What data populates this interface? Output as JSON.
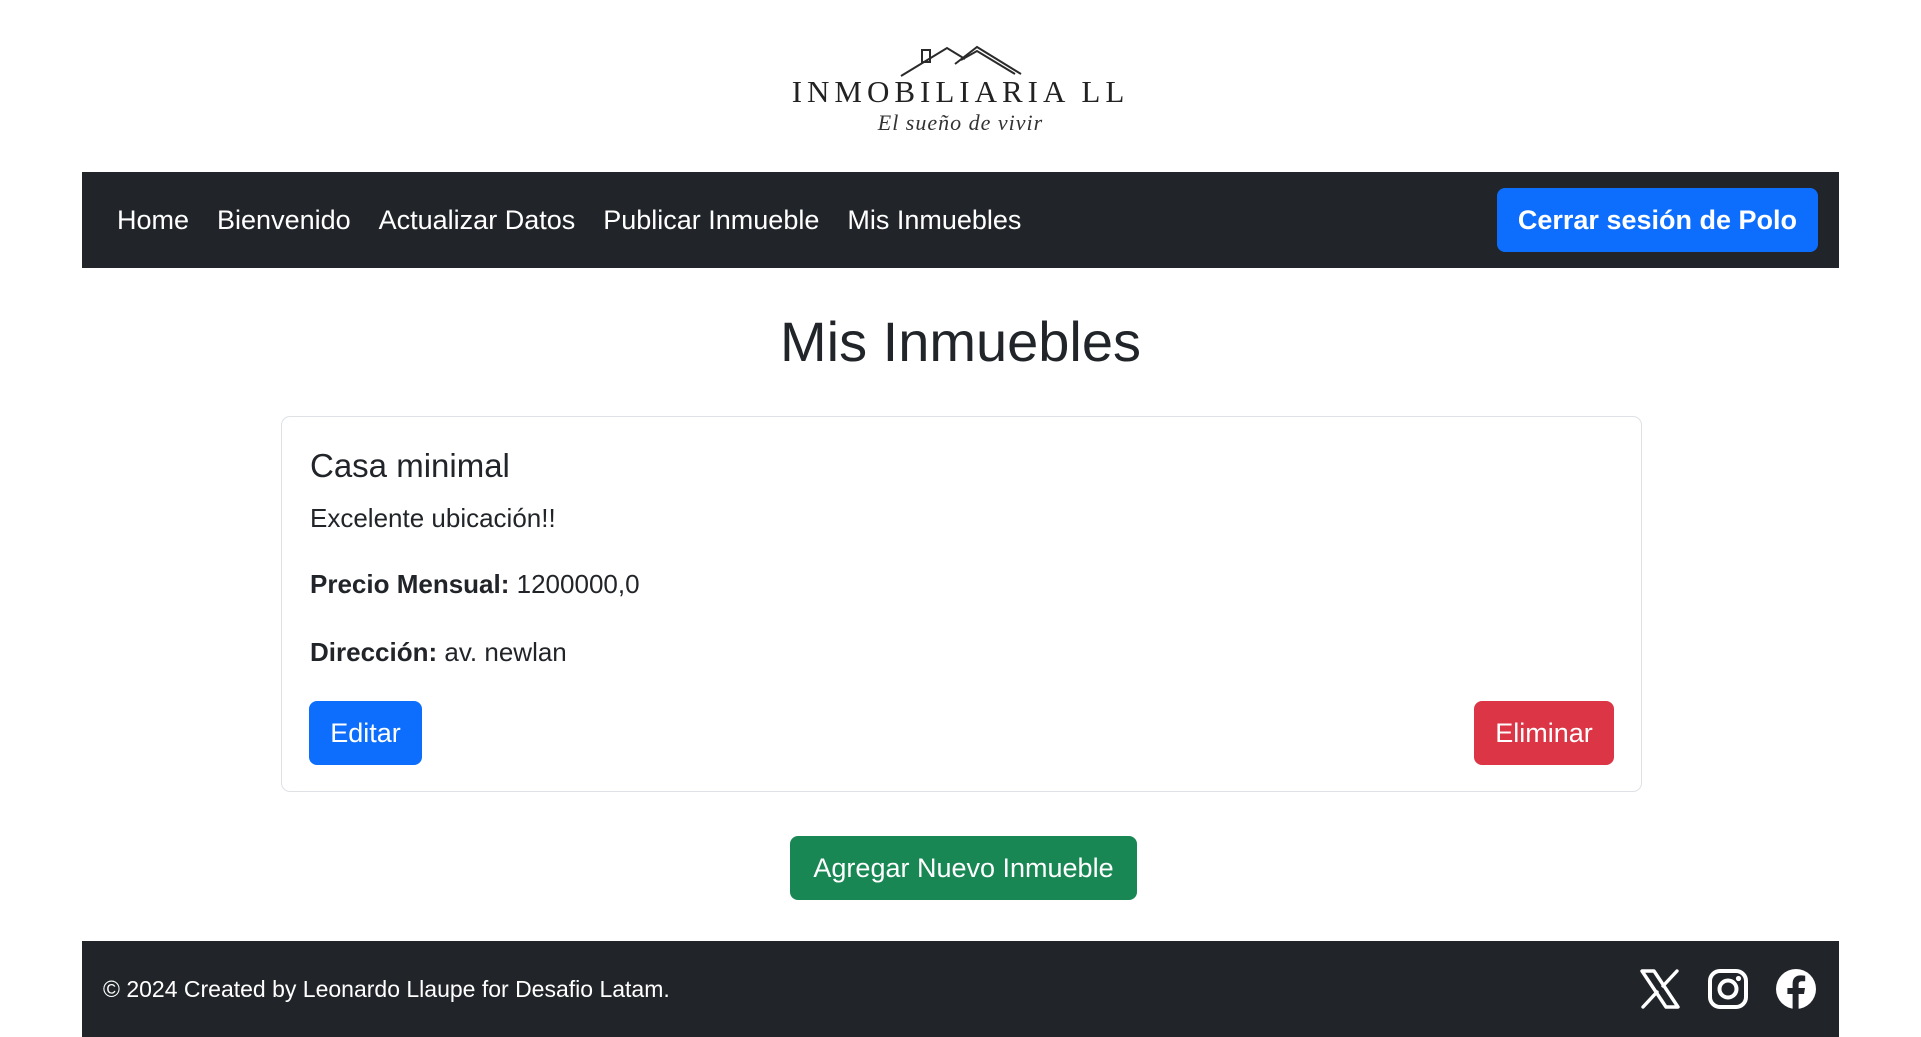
{
  "brand": {
    "name": "INMOBILIARIA LL",
    "tagline": "El sueño de vivir"
  },
  "nav": {
    "links": [
      "Home",
      "Bienvenido",
      "Actualizar Datos",
      "Publicar Inmueble",
      "Mis Inmuebles"
    ],
    "logout_label": "Cerrar sesión de Polo"
  },
  "page": {
    "title": "Mis Inmuebles"
  },
  "property": {
    "title": "Casa minimal",
    "description": "Excelente ubicación!!",
    "price_label": "Precio Mensual:",
    "price_value": "1200000,0",
    "address_label": "Dirección:",
    "address_value": "av. newlan",
    "edit_label": "Editar",
    "delete_label": "Eliminar"
  },
  "add_button_label": "Agregar Nuevo Inmueble",
  "footer": {
    "text": "© 2024 Created by Leonardo Llaupe for Desafio Latam.",
    "social_icons": [
      "x-icon",
      "instagram-icon",
      "facebook-icon"
    ]
  },
  "colors": {
    "navbar_bg": "#212529",
    "primary": "#0d6efd",
    "danger": "#dc3545",
    "success": "#198754"
  }
}
